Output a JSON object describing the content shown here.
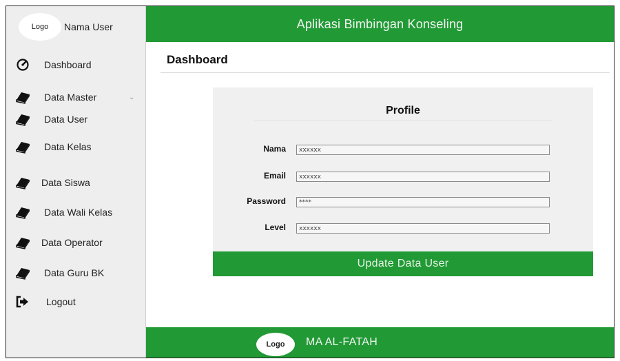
{
  "user": {
    "logo": "Logo",
    "name": "Nama User"
  },
  "sidebar": {
    "items": [
      {
        "label": "Dashboard",
        "icon": "gauge-icon"
      },
      {
        "label": "Data Master",
        "icon": "book-icon",
        "has_submenu": true
      },
      {
        "label": "Data User",
        "icon": "book-icon"
      },
      {
        "label": "Data Kelas",
        "icon": "book-icon"
      },
      {
        "label": "Data Siswa",
        "icon": "book-icon"
      },
      {
        "label": "Data Wali Kelas",
        "icon": "book-icon"
      },
      {
        "label": "Data Operator",
        "icon": "book-icon"
      },
      {
        "label": "Data Guru BK",
        "icon": "book-icon"
      },
      {
        "label": "Logout",
        "icon": "logout-icon"
      }
    ]
  },
  "header": {
    "title": "Aplikasi Bimbingan Konseling"
  },
  "page": {
    "title": "Dashboard"
  },
  "profile": {
    "title": "Profile",
    "fields": [
      {
        "label": "Nama",
        "value": "xxxxxx"
      },
      {
        "label": "Email",
        "value": "xxxxxx"
      },
      {
        "label": "Password",
        "value": "****"
      },
      {
        "label": "Level",
        "value": "xxxxxx"
      }
    ],
    "submit_label": "Update Data User"
  },
  "footer": {
    "logo": "Logo",
    "name": "MA AL-FATAH"
  },
  "colors": {
    "primary": "#219a35",
    "sidebar_bg": "#eeeeee",
    "card_bg": "#f0f0f0"
  }
}
